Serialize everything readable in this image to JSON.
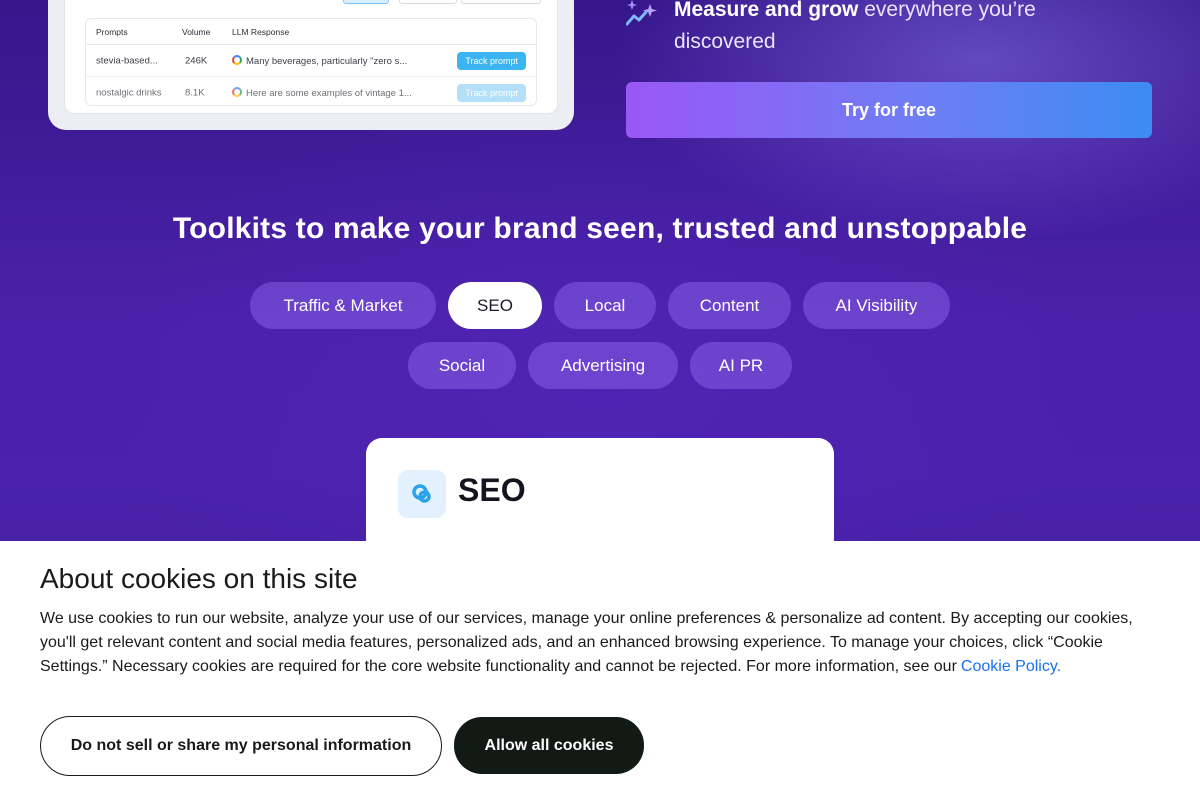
{
  "mock_table": {
    "headers": [
      "Prompts",
      "Volume",
      "LLM Response"
    ],
    "rows": [
      {
        "prompt": "stevia-based...",
        "volume": "246K",
        "response": "Many beverages, particularly \"zero s...",
        "action": "Track prompt"
      },
      {
        "prompt": "nostalgic drinks",
        "volume": "8.1K",
        "response": "Here are some examples of vintage 1...",
        "action": "Track prompt"
      }
    ]
  },
  "hero": {
    "measure_bold": "Measure and grow",
    "measure_rest": " everywhere you’re discovered",
    "cta_label": "Try for free"
  },
  "toolkits": {
    "heading": "Toolkits to make your brand seen, trusted and unstoppable",
    "tabs": [
      {
        "label": "Traffic & Market",
        "active": false
      },
      {
        "label": "SEO",
        "active": true
      },
      {
        "label": "Local",
        "active": false
      },
      {
        "label": "Content",
        "active": false
      },
      {
        "label": "AI Visibility",
        "active": false
      },
      {
        "label": "Social",
        "active": false
      },
      {
        "label": "Advertising",
        "active": false
      },
      {
        "label": "AI PR",
        "active": false
      }
    ]
  },
  "card": {
    "title": "SEO"
  },
  "cookie_banner": {
    "title": "About cookies on this site",
    "body": "We use cookies to run our website, analyze your use of our services, manage your online preferences & personalize ad content. By accepting our cookies, you'll get relevant content and social media features, personalized ads, and an enhanced browsing experience. To manage your choices, click “Cookie Settings.” Necessary cookies are required for the core website functionality and cannot be rejected. For more information, see our",
    "link_label": "Cookie Policy.",
    "decline_label": "Do not sell or share my personal information",
    "accept_label": "Allow all cookies"
  },
  "colors": {
    "background": "#3a1a8c",
    "accent_blue": "#3bb4f2",
    "link": "#1a6ff2"
  }
}
